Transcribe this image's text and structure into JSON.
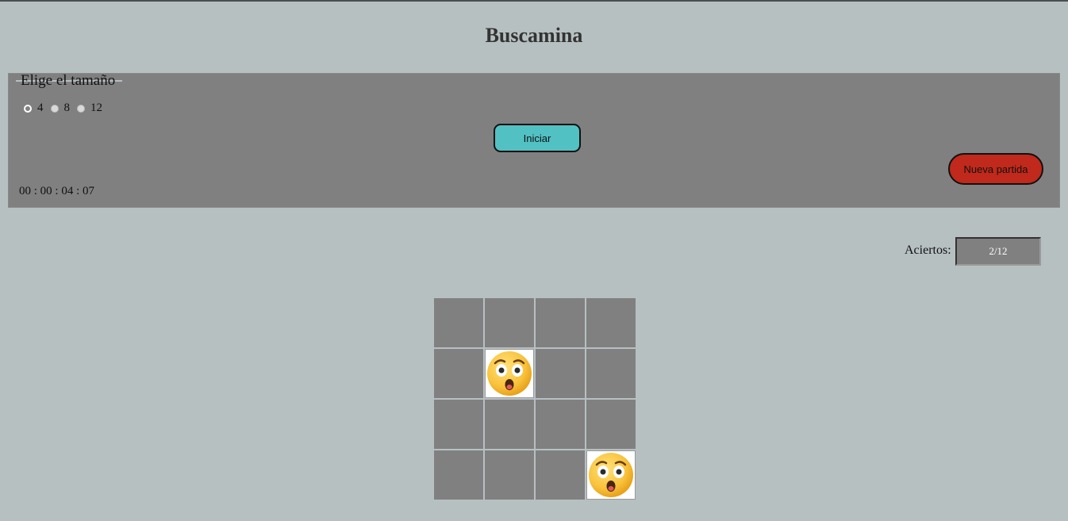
{
  "title": "Buscamina",
  "size_panel": {
    "legend": "Elige el tamaño",
    "options": [
      {
        "label": "4",
        "selected": true
      },
      {
        "label": "8",
        "selected": false
      },
      {
        "label": "12",
        "selected": false
      }
    ],
    "start_button": "Iniciar",
    "new_game_button": "Nueva partida",
    "timer": "00 : 00 : 04 : 07"
  },
  "score": {
    "label": "Aciertos:",
    "value": "2/12"
  },
  "board": {
    "rows": 4,
    "cols": 4,
    "cells": [
      [
        "hidden",
        "hidden",
        "hidden",
        "hidden"
      ],
      [
        "hidden",
        "surprised-face",
        "hidden",
        "hidden"
      ],
      [
        "hidden",
        "hidden",
        "hidden",
        "hidden"
      ],
      [
        "hidden",
        "hidden",
        "hidden",
        "surprised-face"
      ]
    ]
  },
  "colors": {
    "page_background": "#b7c0c1",
    "panel_background": "#808080",
    "start_button": "#52c1c3",
    "new_game_button": "#c0291b"
  }
}
